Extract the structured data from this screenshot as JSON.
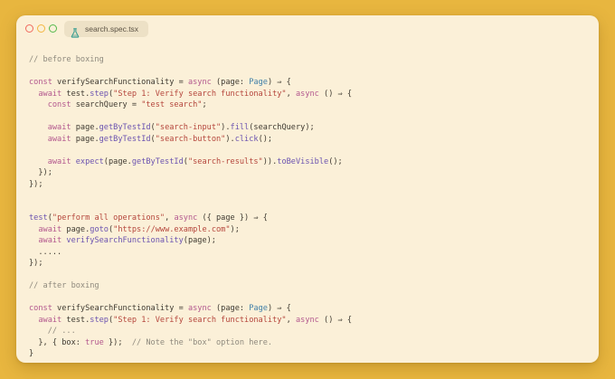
{
  "window": {
    "tab_label": "search.spec.tsx",
    "tab_icon": "flask-icon"
  },
  "colors": {
    "background": "#e8b63f",
    "window": "#fbf0d8",
    "close": "#f0685d",
    "minimize": "#f3b640",
    "maximize": "#54b94b"
  },
  "code": {
    "lines": [
      [
        [
          "comment",
          "// before boxing"
        ]
      ],
      [],
      [
        [
          "keyword",
          "const "
        ],
        [
          "plain",
          "verifySearchFunctionality "
        ],
        [
          "punct",
          "= "
        ],
        [
          "keyword",
          "async "
        ],
        [
          "punct",
          "("
        ],
        [
          "param",
          "page"
        ],
        [
          "punct",
          ": "
        ],
        [
          "type",
          "Page"
        ],
        [
          "punct",
          ") ⇒ {"
        ]
      ],
      [
        [
          "plain",
          "  "
        ],
        [
          "keyword",
          "await "
        ],
        [
          "plain",
          "test."
        ],
        [
          "method",
          "step"
        ],
        [
          "punct",
          "("
        ],
        [
          "string",
          "\"Step 1: Verify search functionality\""
        ],
        [
          "punct",
          ", "
        ],
        [
          "keyword",
          "async "
        ],
        [
          "punct",
          "() ⇒ {"
        ]
      ],
      [
        [
          "plain",
          "    "
        ],
        [
          "keyword",
          "const "
        ],
        [
          "plain",
          "searchQuery "
        ],
        [
          "punct",
          "= "
        ],
        [
          "string",
          "\"test search\""
        ],
        [
          "punct",
          ";"
        ]
      ],
      [],
      [
        [
          "plain",
          "    "
        ],
        [
          "keyword",
          "await "
        ],
        [
          "plain",
          "page."
        ],
        [
          "method",
          "getByTestId"
        ],
        [
          "punct",
          "("
        ],
        [
          "string",
          "\"search-input\""
        ],
        [
          "punct",
          ")."
        ],
        [
          "method",
          "fill"
        ],
        [
          "punct",
          "(searchQuery);"
        ]
      ],
      [
        [
          "plain",
          "    "
        ],
        [
          "keyword",
          "await "
        ],
        [
          "plain",
          "page."
        ],
        [
          "method",
          "getByTestId"
        ],
        [
          "punct",
          "("
        ],
        [
          "string",
          "\"search-button\""
        ],
        [
          "punct",
          ")."
        ],
        [
          "method",
          "click"
        ],
        [
          "punct",
          "();"
        ]
      ],
      [],
      [
        [
          "plain",
          "    "
        ],
        [
          "keyword",
          "await "
        ],
        [
          "method",
          "expect"
        ],
        [
          "punct",
          "(page."
        ],
        [
          "method",
          "getByTestId"
        ],
        [
          "punct",
          "("
        ],
        [
          "string",
          "\"search-results\""
        ],
        [
          "punct",
          "))."
        ],
        [
          "method",
          "toBeVisible"
        ],
        [
          "punct",
          "();"
        ]
      ],
      [
        [
          "punct",
          "  });"
        ]
      ],
      [
        [
          "punct",
          "});"
        ]
      ],
      [],
      [],
      [
        [
          "method",
          "test"
        ],
        [
          "punct",
          "("
        ],
        [
          "string",
          "\"perform all operations\""
        ],
        [
          "punct",
          ", "
        ],
        [
          "keyword",
          "async "
        ],
        [
          "punct",
          "({ page }) ⇒ {"
        ]
      ],
      [
        [
          "plain",
          "  "
        ],
        [
          "keyword",
          "await "
        ],
        [
          "plain",
          "page."
        ],
        [
          "method",
          "goto"
        ],
        [
          "punct",
          "("
        ],
        [
          "string",
          "\"https://www.example.com\""
        ],
        [
          "punct",
          ");"
        ]
      ],
      [
        [
          "plain",
          "  "
        ],
        [
          "keyword",
          "await "
        ],
        [
          "method",
          "verifySearchFunctionality"
        ],
        [
          "punct",
          "(page);"
        ]
      ],
      [
        [
          "plain",
          "  ....."
        ]
      ],
      [
        [
          "punct",
          "});"
        ]
      ],
      [],
      [
        [
          "comment",
          "// after boxing"
        ]
      ],
      [],
      [
        [
          "keyword",
          "const "
        ],
        [
          "plain",
          "verifySearchFunctionality "
        ],
        [
          "punct",
          "= "
        ],
        [
          "keyword",
          "async "
        ],
        [
          "punct",
          "("
        ],
        [
          "param",
          "page"
        ],
        [
          "punct",
          ": "
        ],
        [
          "type",
          "Page"
        ],
        [
          "punct",
          ") ⇒ {"
        ]
      ],
      [
        [
          "plain",
          "  "
        ],
        [
          "keyword",
          "await "
        ],
        [
          "plain",
          "test."
        ],
        [
          "method",
          "step"
        ],
        [
          "punct",
          "("
        ],
        [
          "string",
          "\"Step 1: Verify search functionality\""
        ],
        [
          "punct",
          ", "
        ],
        [
          "keyword",
          "async "
        ],
        [
          "punct",
          "() ⇒ {"
        ]
      ],
      [
        [
          "plain",
          "    "
        ],
        [
          "comment",
          "// ..."
        ]
      ],
      [
        [
          "punct",
          "  }, { box: "
        ],
        [
          "bool",
          "true"
        ],
        [
          "punct",
          " });  "
        ],
        [
          "comment",
          "// Note the \"box\" option here."
        ]
      ],
      [
        [
          "punct",
          "}"
        ]
      ]
    ]
  }
}
